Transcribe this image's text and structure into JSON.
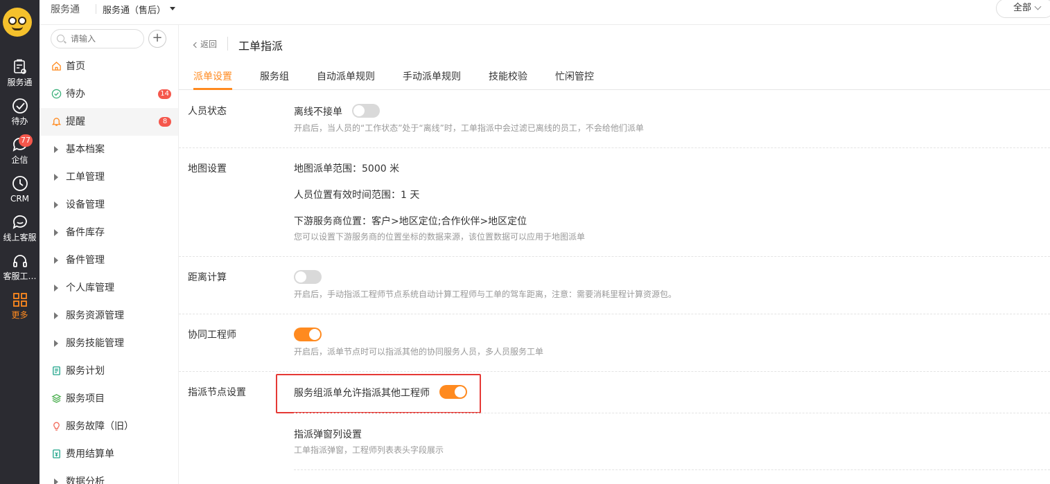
{
  "rail": {
    "items": [
      {
        "label": "服务通",
        "icon": "clipboard-gear-icon"
      },
      {
        "label": "待办",
        "icon": "check-circle-icon"
      },
      {
        "label": "企信",
        "icon": "chat-bubble-icon",
        "badge": "77"
      },
      {
        "label": "CRM",
        "icon": "clock-icon"
      },
      {
        "label": "线上客服",
        "icon": "chat-smile-icon"
      },
      {
        "label": "客服工…",
        "icon": "headset-icon"
      },
      {
        "label": "更多",
        "icon": "grid-icon",
        "active": true
      }
    ]
  },
  "topbar": {
    "app_name": "服务通",
    "module": "服务通（售后）",
    "scope": "全部"
  },
  "sidebar": {
    "search_placeholder": "请输入",
    "items": [
      {
        "label": "首页",
        "icon": "home-icon"
      },
      {
        "label": "待办",
        "icon": "check-circle-icon",
        "badge": "14"
      },
      {
        "label": "提醒",
        "icon": "bell-icon",
        "badge": "8",
        "active": true
      },
      {
        "label": "基本档案",
        "icon": "caret-right-icon"
      },
      {
        "label": "工单管理",
        "icon": "caret-right-icon"
      },
      {
        "label": "设备管理",
        "icon": "caret-right-icon"
      },
      {
        "label": "备件库存",
        "icon": "caret-right-icon"
      },
      {
        "label": "备件管理",
        "icon": "caret-right-icon"
      },
      {
        "label": "个人库管理",
        "icon": "caret-right-icon"
      },
      {
        "label": "服务资源管理",
        "icon": "caret-right-icon"
      },
      {
        "label": "服务技能管理",
        "icon": "caret-right-icon"
      },
      {
        "label": "服务计划",
        "icon": "list-doc-icon"
      },
      {
        "label": "服务项目",
        "icon": "layers-icon"
      },
      {
        "label": "服务故障（旧）",
        "icon": "bulb-icon"
      },
      {
        "label": "费用结算单",
        "icon": "receipt-icon"
      },
      {
        "label": "数据分析",
        "icon": "caret-right-icon"
      }
    ]
  },
  "main": {
    "back_label": "返回",
    "title": "工单指派",
    "tabs": [
      "派单设置",
      "服务组",
      "自动派单规则",
      "手动派单规则",
      "技能校验",
      "忙闲管控"
    ],
    "active_tab": "派单设置",
    "sections": {
      "staff_status": {
        "label": "人员状态",
        "option": "离线不接单",
        "enabled": false,
        "hint": "开启后，当人员的“工作状态”处于“离线”时，工单指派中会过滤已离线的员工，不会给他们派单"
      },
      "map": {
        "label": "地图设置",
        "range": "地图派单范围：5000 米",
        "valid_time": "人员位置有效时间范围：1 天",
        "downstream": "下游服务商位置：客户>地区定位;合作伙伴>地区定位",
        "hint": "您可以设置下游服务商的位置坐标的数据来源，该位置数据可以应用于地图派单"
      },
      "distance": {
        "label": "距离计算",
        "enabled": false,
        "hint": "开启后，手动指派工程师节点系统自动计算工程师与工单的驾车距离，注意：需要消耗里程计算资源包。"
      },
      "coop": {
        "label": "协同工程师",
        "enabled": true,
        "hint": "开启后，派单节点时可以指派其他的协同服务人员，多人员服务工单"
      },
      "assign_node": {
        "label": "指派节点设置",
        "option": "服务组派单允许指派其他工程师",
        "enabled": true,
        "popup_title": "指派弹窗列设置",
        "popup_hint": "工单指派弹窗，工程师列表表头字段展示"
      }
    }
  }
}
